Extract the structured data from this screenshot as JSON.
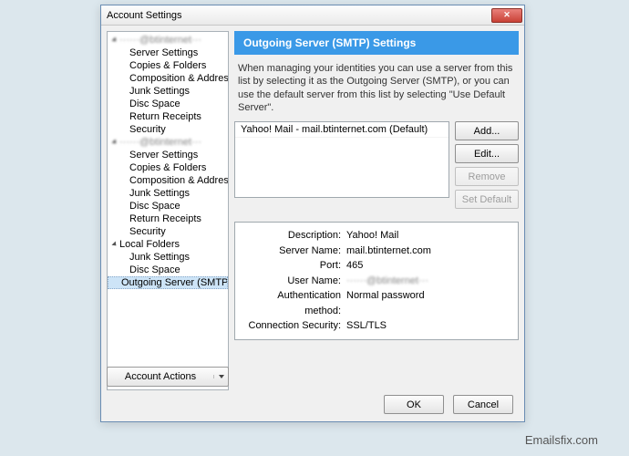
{
  "window": {
    "title": "Account Settings",
    "close_x": "✕"
  },
  "sidebar": {
    "accounts": [
      {
        "name_display": "······@btinternet···",
        "items": [
          "Server Settings",
          "Copies & Folders",
          "Composition & Addressing",
          "Junk Settings",
          "Disc Space",
          "Return Receipts",
          "Security"
        ]
      },
      {
        "name_display": "······@btinternet···",
        "items": [
          "Server Settings",
          "Copies & Folders",
          "Composition & Addressing",
          "Junk Settings",
          "Disc Space",
          "Return Receipts",
          "Security"
        ]
      }
    ],
    "local_folders_label": "Local Folders",
    "local_folders_items": [
      "Junk Settings",
      "Disc Space"
    ],
    "outgoing_label": "Outgoing Server (SMTP)",
    "account_actions_label": "Account Actions"
  },
  "main": {
    "header": "Outgoing Server (SMTP) Settings",
    "description": "When managing your identities you can use a server from this list by selecting it as the Outgoing Server (SMTP), or you can use the default server from this list by selecting \"Use Default Server\".",
    "server_list_item": "Yahoo! Mail - mail.btinternet.com (Default)",
    "buttons": {
      "add": "Add...",
      "edit": "Edit...",
      "remove": "Remove",
      "set_default": "Set Default"
    },
    "details": {
      "description_label": "Description:",
      "description_value": "Yahoo! Mail",
      "server_name_label": "Server Name:",
      "server_name_value": "mail.btinternet.com",
      "port_label": "Port:",
      "port_value": "465",
      "user_name_label": "User Name:",
      "user_name_value": "······@btinternet···",
      "auth_label": "Authentication method:",
      "auth_value": "Normal password",
      "conn_label": "Connection Security:",
      "conn_value": "SSL/TLS"
    }
  },
  "footer": {
    "ok": "OK",
    "cancel": "Cancel"
  },
  "watermark": "Emailsfix.com"
}
